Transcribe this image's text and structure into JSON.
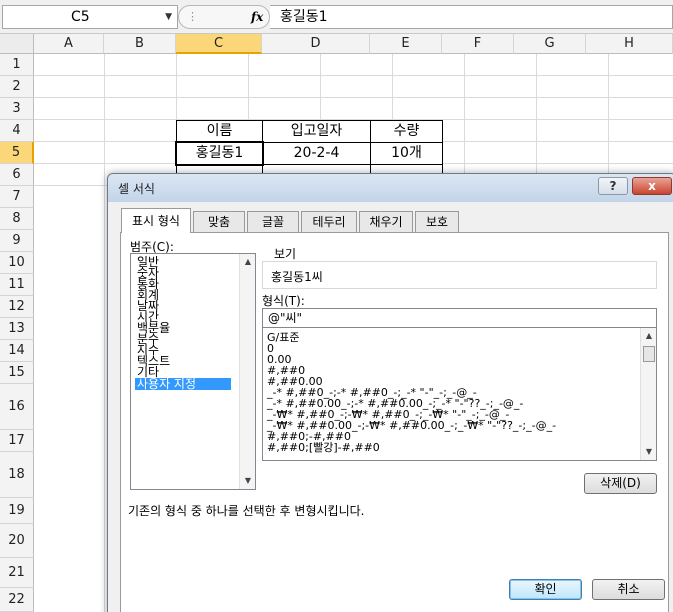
{
  "formula_bar": {
    "name_box": "C5",
    "fx_label": "fx",
    "formula_value": "홍길동1"
  },
  "sheet": {
    "columns": [
      "A",
      "B",
      "C",
      "D",
      "E",
      "F",
      "G",
      "H"
    ],
    "selected_column": "C",
    "rows": [
      "1",
      "2",
      "3",
      "4",
      "5",
      "6",
      "7",
      "8",
      "9",
      "10",
      "11",
      "12",
      "13",
      "14",
      "15",
      "16",
      "17",
      "18",
      "19",
      "20",
      "21",
      "22"
    ],
    "selected_row": "5",
    "table": {
      "headers": [
        "이름",
        "입고일자",
        "수량"
      ],
      "row5": [
        "홍길동1",
        "20-2-4",
        "10개"
      ]
    }
  },
  "dialog": {
    "title": "셀 서식",
    "help_label": "?",
    "close_label": "x",
    "tabs": [
      "표시 형식",
      "맞춤",
      "글꼴",
      "테두리",
      "채우기",
      "보호"
    ],
    "active_tab": "표시 형식",
    "category_label": "범주(C):",
    "categories": [
      "일반",
      "숫자",
      "통화",
      "회계",
      "날짜",
      "시간",
      "백분율",
      "분수",
      "지수",
      "텍스트",
      "기타",
      "사용자 지정"
    ],
    "selected_category": "사용자 지정",
    "preview_label": "보기",
    "preview_value": "홍길동1씨",
    "type_label": "형식(T):",
    "type_value": "@\"씨\"",
    "type_list": [
      "G/표준",
      "0",
      "0.00",
      "#,##0",
      "#,##0.00",
      "_-* #,##0_-;-* #,##0_-;_-* \"-\"_-;_-@_-",
      "_-* #,##0.00_-;-* #,##0.00_-;_-* \"-\"??_-;_-@_-",
      "_-₩* #,##0_-;-₩* #,##0_-;_-₩* \"-\"_-;_-@_-",
      "_-₩* #,##0.00_-;-₩* #,##0.00_-;_-₩* \"-\"??_-;_-@_-",
      "#,##0;-#,##0",
      "#,##0;[빨강]-#,##0"
    ],
    "delete_button": "삭제(D)",
    "description": "기존의 형식 중 하나를 선택한 후 변형시킵니다.",
    "ok_button": "확인",
    "cancel_button": "취소"
  }
}
